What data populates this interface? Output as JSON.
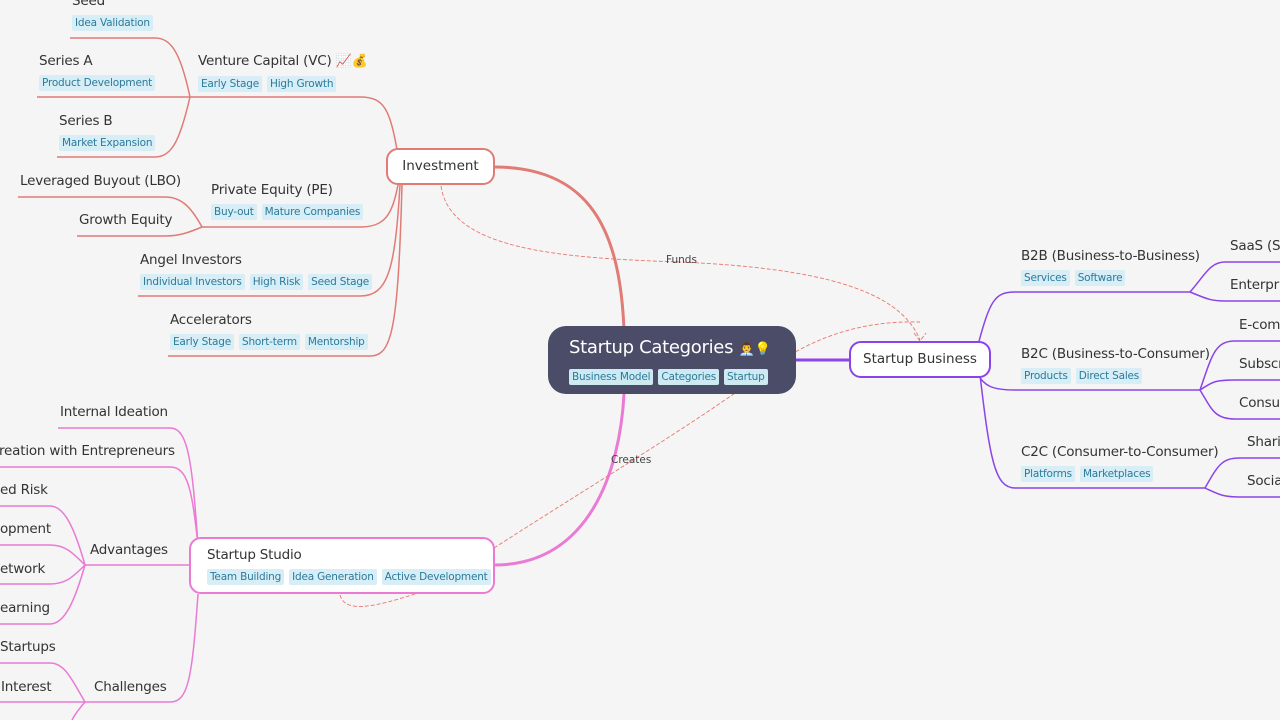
{
  "root": {
    "title": "Startup Categories",
    "emoji": "👨‍💼💡",
    "tags": [
      "Business Model",
      "Categories",
      "Startup"
    ]
  },
  "branches": {
    "investment": {
      "label": "Investment",
      "color": "#e07b76",
      "children": {
        "vc": {
          "title": "Venture Capital (VC)",
          "emoji": "📈💰",
          "tags": [
            "Early Stage",
            "High Growth"
          ],
          "children": {
            "seed": {
              "title": "Seed",
              "tags": [
                "Idea Validation"
              ]
            },
            "series_a": {
              "title": "Series A",
              "tags": [
                "Product Development"
              ]
            },
            "series_b": {
              "title": "Series B",
              "tags": [
                "Market Expansion"
              ]
            }
          }
        },
        "pe": {
          "title": "Private Equity (PE)",
          "tags": [
            "Buy-out",
            "Mature Companies"
          ],
          "children": {
            "lbo": {
              "title": "Leveraged Buyout (LBO)"
            },
            "growth": {
              "title": "Growth Equity"
            }
          }
        },
        "angel": {
          "title": "Angel Investors",
          "tags": [
            "Individual Investors",
            "High Risk",
            "Seed Stage"
          ]
        },
        "accel": {
          "title": "Accelerators",
          "tags": [
            "Early Stage",
            "Short-term",
            "Mentorship"
          ]
        }
      }
    },
    "business": {
      "label": "Startup Business",
      "color": "#8b44e8",
      "children": {
        "b2b": {
          "title": "B2B (Business-to-Business)",
          "tags": [
            "Services",
            "Software"
          ],
          "children": [
            "SaaS (So",
            "Enterpri"
          ]
        },
        "b2c": {
          "title": "B2C (Business-to-Consumer)",
          "tags": [
            "Products",
            "Direct Sales"
          ],
          "children": [
            "E-comm",
            "Subscr",
            "Consur"
          ]
        },
        "c2c": {
          "title": "C2C (Consumer-to-Consumer)",
          "tags": [
            "Platforms",
            "Marketplaces"
          ],
          "children": [
            "Sharin",
            "Socia"
          ]
        }
      }
    },
    "studio": {
      "label": "Startup Studio",
      "color": "#ea7ad4",
      "tags": [
        "Team Building",
        "Idea Generation",
        "Active Development"
      ],
      "children": {
        "internal": {
          "title": "Internal Ideation"
        },
        "cocreation": {
          "title": "reation with Entrepreneurs"
        },
        "advantages": {
          "title": "Advantages",
          "children": [
            "ed Risk",
            "opment",
            "etwork",
            "earning"
          ]
        },
        "challenges": {
          "title": "Challenges",
          "children": [
            "Startups",
            "Interest"
          ]
        }
      }
    }
  },
  "relations": {
    "funds": "Funds",
    "creates": "Creates"
  }
}
